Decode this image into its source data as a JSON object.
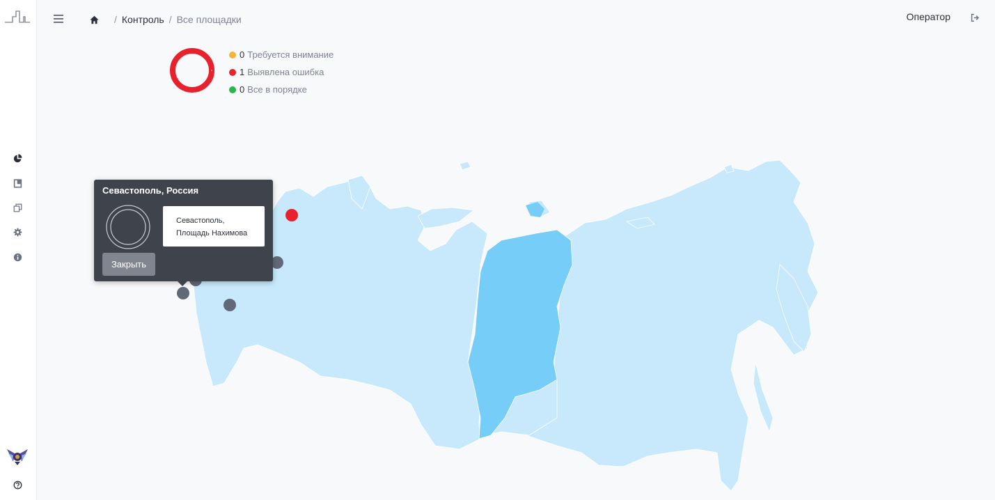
{
  "breadcrumb": {
    "home_icon": "home-icon",
    "items": [
      "Контроль",
      "Все площадки"
    ],
    "separator": "/"
  },
  "header": {
    "user": "Оператор",
    "logout_icon": "sign-out-icon"
  },
  "sidebar": {
    "items": [
      {
        "icon": "pie-chart-icon"
      },
      {
        "icon": "book-icon"
      },
      {
        "icon": "copy-icon"
      },
      {
        "icon": "gear-icon"
      },
      {
        "icon": "info-icon"
      }
    ],
    "help_icon": "question-circle-icon"
  },
  "summary": {
    "items": [
      {
        "count": "0",
        "label": "Требуется внимание",
        "color": "#f5b638"
      },
      {
        "count": "1",
        "label": "Выявлена ошибка",
        "color": "#e8222d"
      },
      {
        "count": "0",
        "label": "Все в порядке",
        "color": "#2bb64b"
      }
    ],
    "donut_color": "#e8222d"
  },
  "map": {
    "region_color": "#c7e9fb",
    "highlight_color": "#76cdf8",
    "markers": [
      {
        "status": "error",
        "color": "#e8222d"
      },
      {
        "status": "inactive",
        "color": "#616978"
      },
      {
        "status": "inactive",
        "color": "#616978"
      },
      {
        "status": "inactive",
        "color": "#616978"
      },
      {
        "status": "inactive",
        "color": "#616978"
      }
    ]
  },
  "popup": {
    "title": "Севастополь, Россия",
    "address_line1": "Севастополь,",
    "address_line2": "Площадь Нахимова",
    "close_button": "Закрыть"
  }
}
